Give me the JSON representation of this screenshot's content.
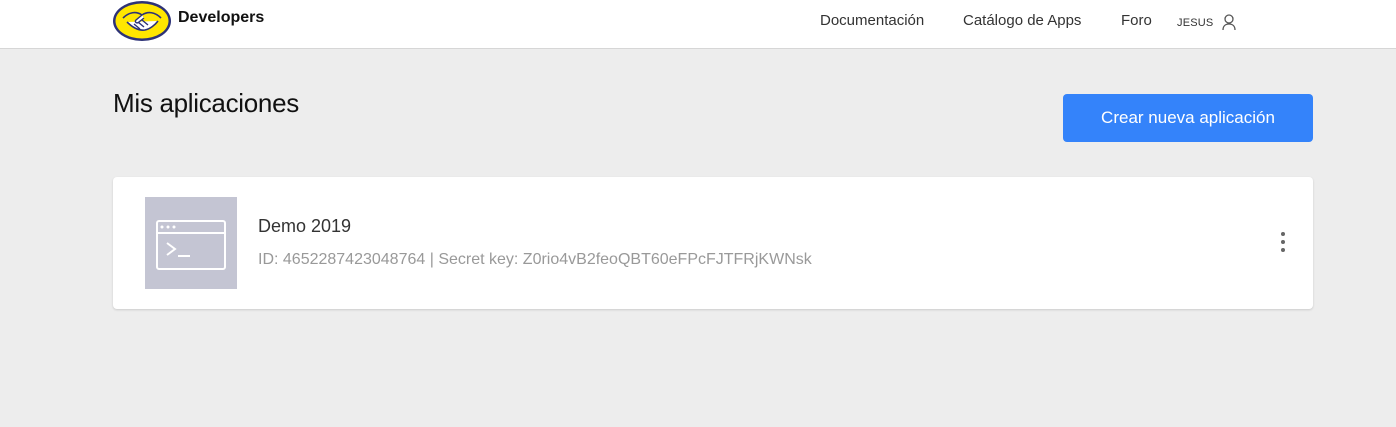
{
  "header": {
    "brand": "Developers",
    "nav": {
      "documentation": "Documentación",
      "apps_catalog": "Catálogo de Apps",
      "forum": "Foro"
    },
    "user": {
      "name": "JESUS"
    }
  },
  "main": {
    "title": "Mis aplicaciones",
    "create_button": "Crear nueva aplicación",
    "apps": [
      {
        "name": "Demo 2019",
        "meta": "ID: 4652287423048764 | Secret key: Z0rio4vB2feoQBT60eFPcFJTFRjKWNsk"
      }
    ]
  },
  "colors": {
    "accent": "#3483fa",
    "brand_yellow": "#ffe600",
    "brand_navy": "#2d3277",
    "background": "#ededed"
  }
}
